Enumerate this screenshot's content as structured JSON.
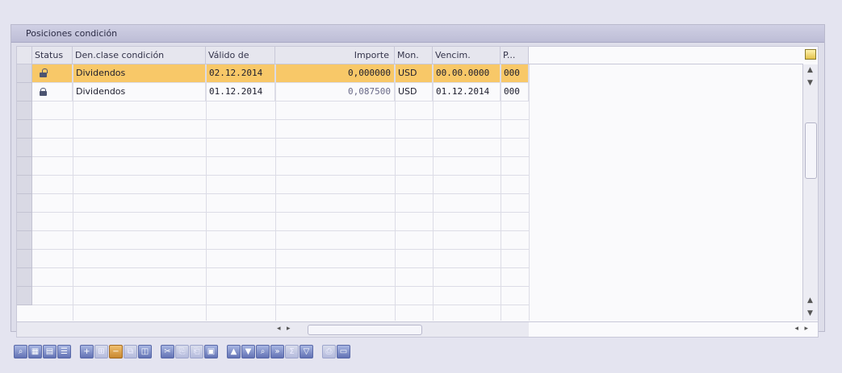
{
  "panel": {
    "title": "Posiciones condición"
  },
  "columns": [
    {
      "key": "status",
      "label": "Status"
    },
    {
      "key": "den",
      "label": "Den.clase condición"
    },
    {
      "key": "valido",
      "label": "Válido de"
    },
    {
      "key": "importe",
      "label": "Importe"
    },
    {
      "key": "mon",
      "label": "Mon."
    },
    {
      "key": "vencim",
      "label": "Vencim."
    },
    {
      "key": "p",
      "label": "P..."
    }
  ],
  "rows": [
    {
      "status_icon": "unlocked-icon",
      "den": "Dividendos",
      "valido": "02.12.2014",
      "importe": "0,000000",
      "mon": "USD",
      "vencim": "00.00.0000",
      "p": "000",
      "selected": true
    },
    {
      "status_icon": "locked-icon",
      "den": "Dividendos",
      "valido": "01.12.2014",
      "importe": "0,087500",
      "mon": "USD",
      "vencim": "01.12.2014",
      "p": "000",
      "selected": false
    }
  ],
  "empty_rows": 11,
  "colors": {
    "selected_row": "#f8c868",
    "background": "#e4e4f0"
  },
  "toolbar": {
    "icons": [
      "details-icon",
      "select-all-icon",
      "deselect-all-icon",
      "choose-icon",
      "insert-row-icon",
      "append-row-icon",
      "delete-row-icon",
      "copy-row-icon",
      "duplicate-icon",
      "cut-icon",
      "copy-icon",
      "paste-icon",
      "paste-new-icon",
      "sort-ascending-icon",
      "sort-descending-icon",
      "find-icon",
      "find-next-icon",
      "total-icon",
      "filter-icon",
      "print-icon",
      "export-icon"
    ]
  }
}
